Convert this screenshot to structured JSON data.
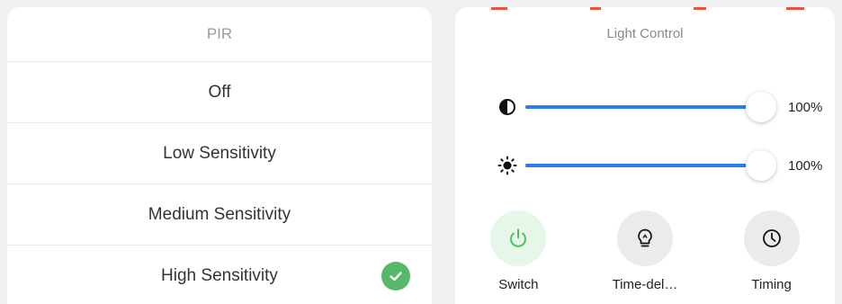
{
  "pir": {
    "title": "PIR",
    "options": [
      {
        "label": "Off",
        "selected": false
      },
      {
        "label": "Low Sensitivity",
        "selected": false
      },
      {
        "label": "Medium Sensitivity",
        "selected": false
      },
      {
        "label": "High Sensitivity",
        "selected": true
      }
    ]
  },
  "light_control": {
    "title": "Light Control",
    "sliders": [
      {
        "icon": "contrast-icon",
        "value": 100,
        "value_label": "100%"
      },
      {
        "icon": "brightness-icon",
        "value": 100,
        "value_label": "100%"
      }
    ],
    "actions": [
      {
        "icon": "power-icon",
        "label": "Switch",
        "active": true
      },
      {
        "icon": "bulb-icon",
        "label": "Time-del…",
        "active": false
      },
      {
        "icon": "clock-icon",
        "label": "Timing",
        "active": false
      }
    ]
  },
  "colors": {
    "accent_blue": "#2b7de9",
    "check_green": "#56b868",
    "power_green": "#4cc25c"
  }
}
